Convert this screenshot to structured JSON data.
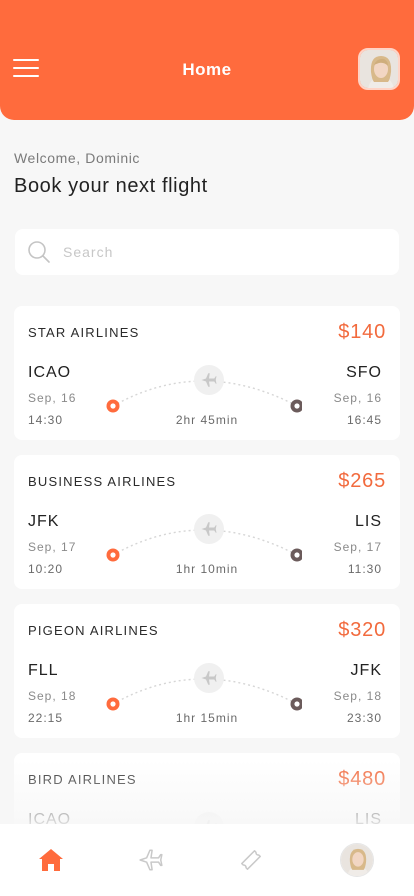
{
  "header": {
    "title": "Home",
    "menu_icon": "hamburger-menu-icon",
    "avatar_icon": "user-avatar-photo"
  },
  "welcome": "Welcome, Dominic",
  "headline": "Book your next flight",
  "search": {
    "placeholder": "Search",
    "value": "",
    "icon": "search-icon"
  },
  "flights": [
    {
      "airline": "STAR AIRLINES",
      "price": "$140",
      "from": "ICAO",
      "to": "SFO",
      "from_date": "Sep, 16",
      "to_date": "Sep, 16",
      "from_time": "14:30",
      "to_time": "16:45",
      "duration": "2hr 45min"
    },
    {
      "airline": "BUSINESS AIRLINES",
      "price": "$265",
      "from": "JFK",
      "to": "LIS",
      "from_date": "Sep, 17",
      "to_date": "Sep, 17",
      "from_time": "10:20",
      "to_time": "11:30",
      "duration": "1hr 10min"
    },
    {
      "airline": "PIGEON AIRLINES",
      "price": "$320",
      "from": "FLL",
      "to": "JFK",
      "from_date": "Sep, 18",
      "to_date": "Sep, 18",
      "from_time": "22:15",
      "to_time": "23:30",
      "duration": "1hr 15min"
    },
    {
      "airline": "BIRD AIRLINES",
      "price": "$480",
      "from": "ICAO",
      "to": "LIS",
      "from_date": "",
      "to_date": "",
      "from_time": "",
      "to_time": "",
      "duration": ""
    }
  ],
  "tabbar": {
    "items": [
      {
        "icon": "home-icon",
        "active": true
      },
      {
        "icon": "airplane-icon",
        "active": false
      },
      {
        "icon": "ticket-icon",
        "active": false
      },
      {
        "icon": "profile-avatar",
        "active": false
      }
    ]
  },
  "colors": {
    "accent": "#ff6b3d",
    "price": "#f26a3d",
    "destination_dot": "#6b5b5b",
    "background": "#f7f7f7"
  }
}
